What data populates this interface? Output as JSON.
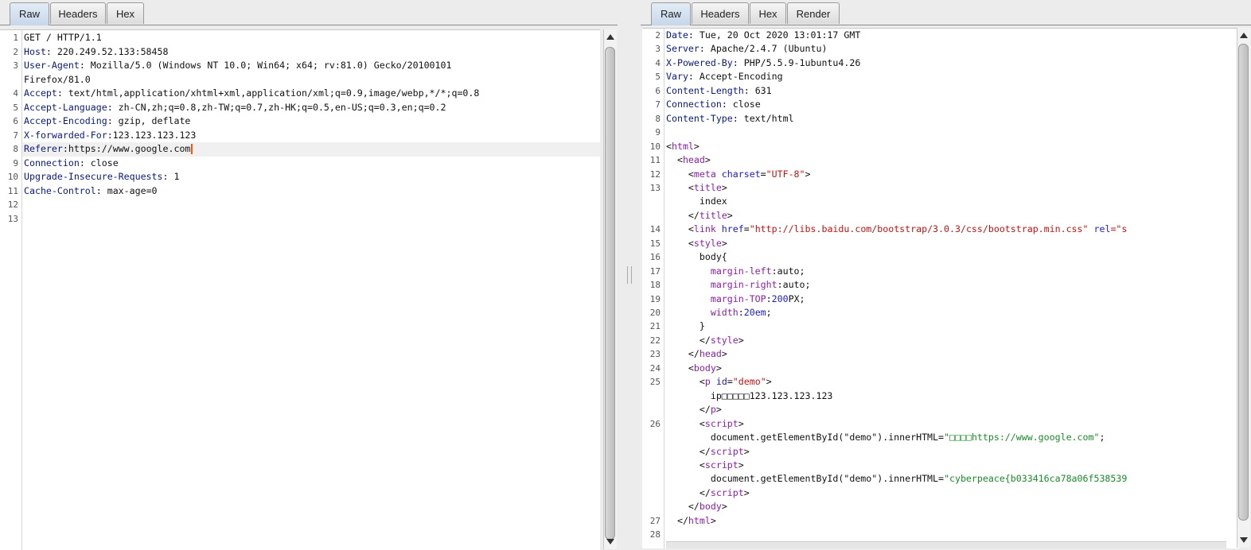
{
  "request": {
    "tabs": [
      "Raw",
      "Headers",
      "Hex"
    ],
    "active_tab": "Raw",
    "lines": [
      {
        "n": "1",
        "parts": [
          {
            "t": "GET / HTTP/1.1",
            "c": ""
          }
        ]
      },
      {
        "n": "2",
        "parts": [
          {
            "t": "Host",
            "c": "k"
          },
          {
            "t": ": 220.249.52.133:58458",
            "c": ""
          }
        ]
      },
      {
        "n": "3",
        "parts": [
          {
            "t": "User-Agent",
            "c": "k"
          },
          {
            "t": ": Mozilla/5.0 (Windows NT 10.0; Win64; x64; rv:81.0) Gecko/20100101",
            "c": ""
          }
        ]
      },
      {
        "n": "",
        "parts": [
          {
            "t": "Firefox/81.0",
            "c": ""
          }
        ]
      },
      {
        "n": "4",
        "parts": [
          {
            "t": "Accept",
            "c": "k"
          },
          {
            "t": ": text/html,application/xhtml+xml,application/xml;q=0.9,image/webp,*/*;q=0.8",
            "c": ""
          }
        ]
      },
      {
        "n": "5",
        "parts": [
          {
            "t": "Accept-Language",
            "c": "k"
          },
          {
            "t": ": zh-CN,zh;q=0.8,zh-TW;q=0.7,zh-HK;q=0.5,en-US;q=0.3,en;q=0.2",
            "c": ""
          }
        ]
      },
      {
        "n": "6",
        "parts": [
          {
            "t": "Accept-Encoding",
            "c": "k"
          },
          {
            "t": ": gzip, deflate",
            "c": ""
          }
        ]
      },
      {
        "n": "7",
        "parts": [
          {
            "t": "X-forwarded-For",
            "c": "k"
          },
          {
            "t": ":123.123.123.123",
            "c": ""
          }
        ]
      },
      {
        "n": "8",
        "parts": [
          {
            "t": "Referer",
            "c": "k"
          },
          {
            "t": ":https://www.google.com",
            "c": ""
          }
        ],
        "current": true
      },
      {
        "n": "9",
        "parts": [
          {
            "t": "Connection",
            "c": "k"
          },
          {
            "t": ": close",
            "c": ""
          }
        ]
      },
      {
        "n": "10",
        "parts": [
          {
            "t": "Upgrade-Insecure-Requests",
            "c": "k"
          },
          {
            "t": ": 1",
            "c": ""
          }
        ]
      },
      {
        "n": "11",
        "parts": [
          {
            "t": "Cache-Control",
            "c": "k"
          },
          {
            "t": ": max-age=0",
            "c": ""
          }
        ]
      },
      {
        "n": "12",
        "parts": []
      },
      {
        "n": "13",
        "parts": []
      }
    ]
  },
  "response": {
    "tabs": [
      "Raw",
      "Headers",
      "Hex",
      "Render"
    ],
    "active_tab": "Raw",
    "lines": [
      {
        "n": "2",
        "parts": [
          {
            "t": "Date",
            "c": "k"
          },
          {
            "t": ": Tue, 20 Oct 2020 13:01:17 GMT",
            "c": ""
          }
        ]
      },
      {
        "n": "3",
        "parts": [
          {
            "t": "Server",
            "c": "k"
          },
          {
            "t": ": Apache/2.4.7 (Ubuntu)",
            "c": ""
          }
        ]
      },
      {
        "n": "4",
        "parts": [
          {
            "t": "X-Powered-By",
            "c": "k"
          },
          {
            "t": ": PHP/5.5.9-1ubuntu4.26",
            "c": ""
          }
        ]
      },
      {
        "n": "5",
        "parts": [
          {
            "t": "Vary",
            "c": "k"
          },
          {
            "t": ": Accept-Encoding",
            "c": ""
          }
        ]
      },
      {
        "n": "6",
        "parts": [
          {
            "t": "Content-Length",
            "c": "k"
          },
          {
            "t": ": 631",
            "c": ""
          }
        ]
      },
      {
        "n": "7",
        "parts": [
          {
            "t": "Connection",
            "c": "k"
          },
          {
            "t": ": close",
            "c": ""
          }
        ]
      },
      {
        "n": "8",
        "parts": [
          {
            "t": "Content-Type",
            "c": "k"
          },
          {
            "t": ": text/html",
            "c": ""
          }
        ]
      },
      {
        "n": "9",
        "parts": []
      },
      {
        "n": "10",
        "parts": [
          {
            "t": "<",
            "c": ""
          },
          {
            "t": "html",
            "c": "tg"
          },
          {
            "t": ">",
            "c": ""
          }
        ]
      },
      {
        "n": "11",
        "parts": [
          {
            "t": "  <",
            "c": ""
          },
          {
            "t": "head",
            "c": "tg"
          },
          {
            "t": ">",
            "c": ""
          }
        ]
      },
      {
        "n": "12",
        "parts": [
          {
            "t": "    <",
            "c": ""
          },
          {
            "t": "meta",
            "c": "tg"
          },
          {
            "t": " charset",
            "c": "at"
          },
          {
            "t": "=",
            "c": ""
          },
          {
            "t": "\"UTF-8\"",
            "c": "st"
          },
          {
            "t": ">",
            "c": ""
          }
        ]
      },
      {
        "n": "13",
        "parts": [
          {
            "t": "    <",
            "c": ""
          },
          {
            "t": "title",
            "c": "tg"
          },
          {
            "t": ">",
            "c": ""
          }
        ]
      },
      {
        "n": "",
        "parts": [
          {
            "t": "      index",
            "c": ""
          }
        ]
      },
      {
        "n": "",
        "parts": [
          {
            "t": "    </",
            "c": ""
          },
          {
            "t": "title",
            "c": "tg"
          },
          {
            "t": ">",
            "c": ""
          }
        ]
      },
      {
        "n": "14",
        "parts": [
          {
            "t": "    <",
            "c": ""
          },
          {
            "t": "link",
            "c": "tg"
          },
          {
            "t": " href",
            "c": "at"
          },
          {
            "t": "=",
            "c": ""
          },
          {
            "t": "\"http://libs.baidu.com/bootstrap/3.0.3/css/bootstrap.min.css\"",
            "c": "st"
          },
          {
            "t": " rel",
            "c": "at"
          },
          {
            "t": "=\"s",
            "c": "st"
          }
        ]
      },
      {
        "n": "15",
        "parts": [
          {
            "t": "    <",
            "c": ""
          },
          {
            "t": "style",
            "c": "tg"
          },
          {
            "t": ">",
            "c": ""
          }
        ]
      },
      {
        "n": "16",
        "parts": [
          {
            "t": "      body{",
            "c": ""
          }
        ]
      },
      {
        "n": "17",
        "parts": [
          {
            "t": "        ",
            "c": ""
          },
          {
            "t": "margin-left",
            "c": "tg"
          },
          {
            "t": ":auto;",
            "c": ""
          }
        ]
      },
      {
        "n": "18",
        "parts": [
          {
            "t": "        ",
            "c": ""
          },
          {
            "t": "margin-right",
            "c": "tg"
          },
          {
            "t": ":auto;",
            "c": ""
          }
        ]
      },
      {
        "n": "19",
        "parts": [
          {
            "t": "        ",
            "c": ""
          },
          {
            "t": "margin-TOP",
            "c": "tg"
          },
          {
            "t": ":",
            "c": ""
          },
          {
            "t": "200",
            "c": "nm"
          },
          {
            "t": "PX;",
            "c": ""
          }
        ]
      },
      {
        "n": "20",
        "parts": [
          {
            "t": "        ",
            "c": ""
          },
          {
            "t": "width",
            "c": "tg"
          },
          {
            "t": ":",
            "c": ""
          },
          {
            "t": "20em",
            "c": "nm"
          },
          {
            "t": ";",
            "c": ""
          }
        ]
      },
      {
        "n": "21",
        "parts": [
          {
            "t": "      }",
            "c": ""
          }
        ]
      },
      {
        "n": "22",
        "parts": [
          {
            "t": "      </",
            "c": ""
          },
          {
            "t": "style",
            "c": "tg"
          },
          {
            "t": ">",
            "c": ""
          }
        ]
      },
      {
        "n": "23",
        "parts": [
          {
            "t": "    </",
            "c": ""
          },
          {
            "t": "head",
            "c": "tg"
          },
          {
            "t": ">",
            "c": ""
          }
        ]
      },
      {
        "n": "24",
        "parts": [
          {
            "t": "    <",
            "c": ""
          },
          {
            "t": "body",
            "c": "tg"
          },
          {
            "t": ">",
            "c": ""
          }
        ]
      },
      {
        "n": "25",
        "parts": [
          {
            "t": "      <",
            "c": ""
          },
          {
            "t": "p",
            "c": "tg"
          },
          {
            "t": " id",
            "c": "at"
          },
          {
            "t": "=",
            "c": ""
          },
          {
            "t": "\"demo\"",
            "c": "st"
          },
          {
            "t": ">",
            "c": ""
          }
        ]
      },
      {
        "n": "",
        "parts": [
          {
            "t": "        ip□□□□□123.123.123.123",
            "c": ""
          }
        ]
      },
      {
        "n": "",
        "parts": [
          {
            "t": "      </",
            "c": ""
          },
          {
            "t": "p",
            "c": "tg"
          },
          {
            "t": ">",
            "c": ""
          }
        ]
      },
      {
        "n": "26",
        "parts": [
          {
            "t": "      <",
            "c": ""
          },
          {
            "t": "script",
            "c": "tg"
          },
          {
            "t": ">",
            "c": ""
          }
        ]
      },
      {
        "n": "",
        "parts": [
          {
            "t": "        document.getElementById(\"demo\").innerHTML=",
            "c": ""
          },
          {
            "t": "\"□□□□https://www.google.com\"",
            "c": "gr"
          },
          {
            "t": ";",
            "c": ""
          }
        ]
      },
      {
        "n": "",
        "parts": [
          {
            "t": "      </",
            "c": ""
          },
          {
            "t": "script",
            "c": "tg"
          },
          {
            "t": ">",
            "c": ""
          }
        ]
      },
      {
        "n": "",
        "parts": [
          {
            "t": "      <",
            "c": ""
          },
          {
            "t": "script",
            "c": "tg"
          },
          {
            "t": ">",
            "c": ""
          }
        ]
      },
      {
        "n": "",
        "parts": [
          {
            "t": "        document.getElementById(\"demo\").innerHTML=",
            "c": ""
          },
          {
            "t": "\"cyberpeace{b033416ca78a06f538539",
            "c": "gr"
          }
        ]
      },
      {
        "n": "",
        "parts": [
          {
            "t": "      </",
            "c": ""
          },
          {
            "t": "script",
            "c": "tg"
          },
          {
            "t": ">",
            "c": ""
          }
        ]
      },
      {
        "n": "",
        "parts": [
          {
            "t": "    </",
            "c": ""
          },
          {
            "t": "body",
            "c": "tg"
          },
          {
            "t": ">",
            "c": ""
          }
        ]
      },
      {
        "n": "27",
        "parts": [
          {
            "t": "  </",
            "c": ""
          },
          {
            "t": "html",
            "c": "tg"
          },
          {
            "t": ">",
            "c": ""
          }
        ]
      },
      {
        "n": "28",
        "parts": []
      }
    ]
  }
}
